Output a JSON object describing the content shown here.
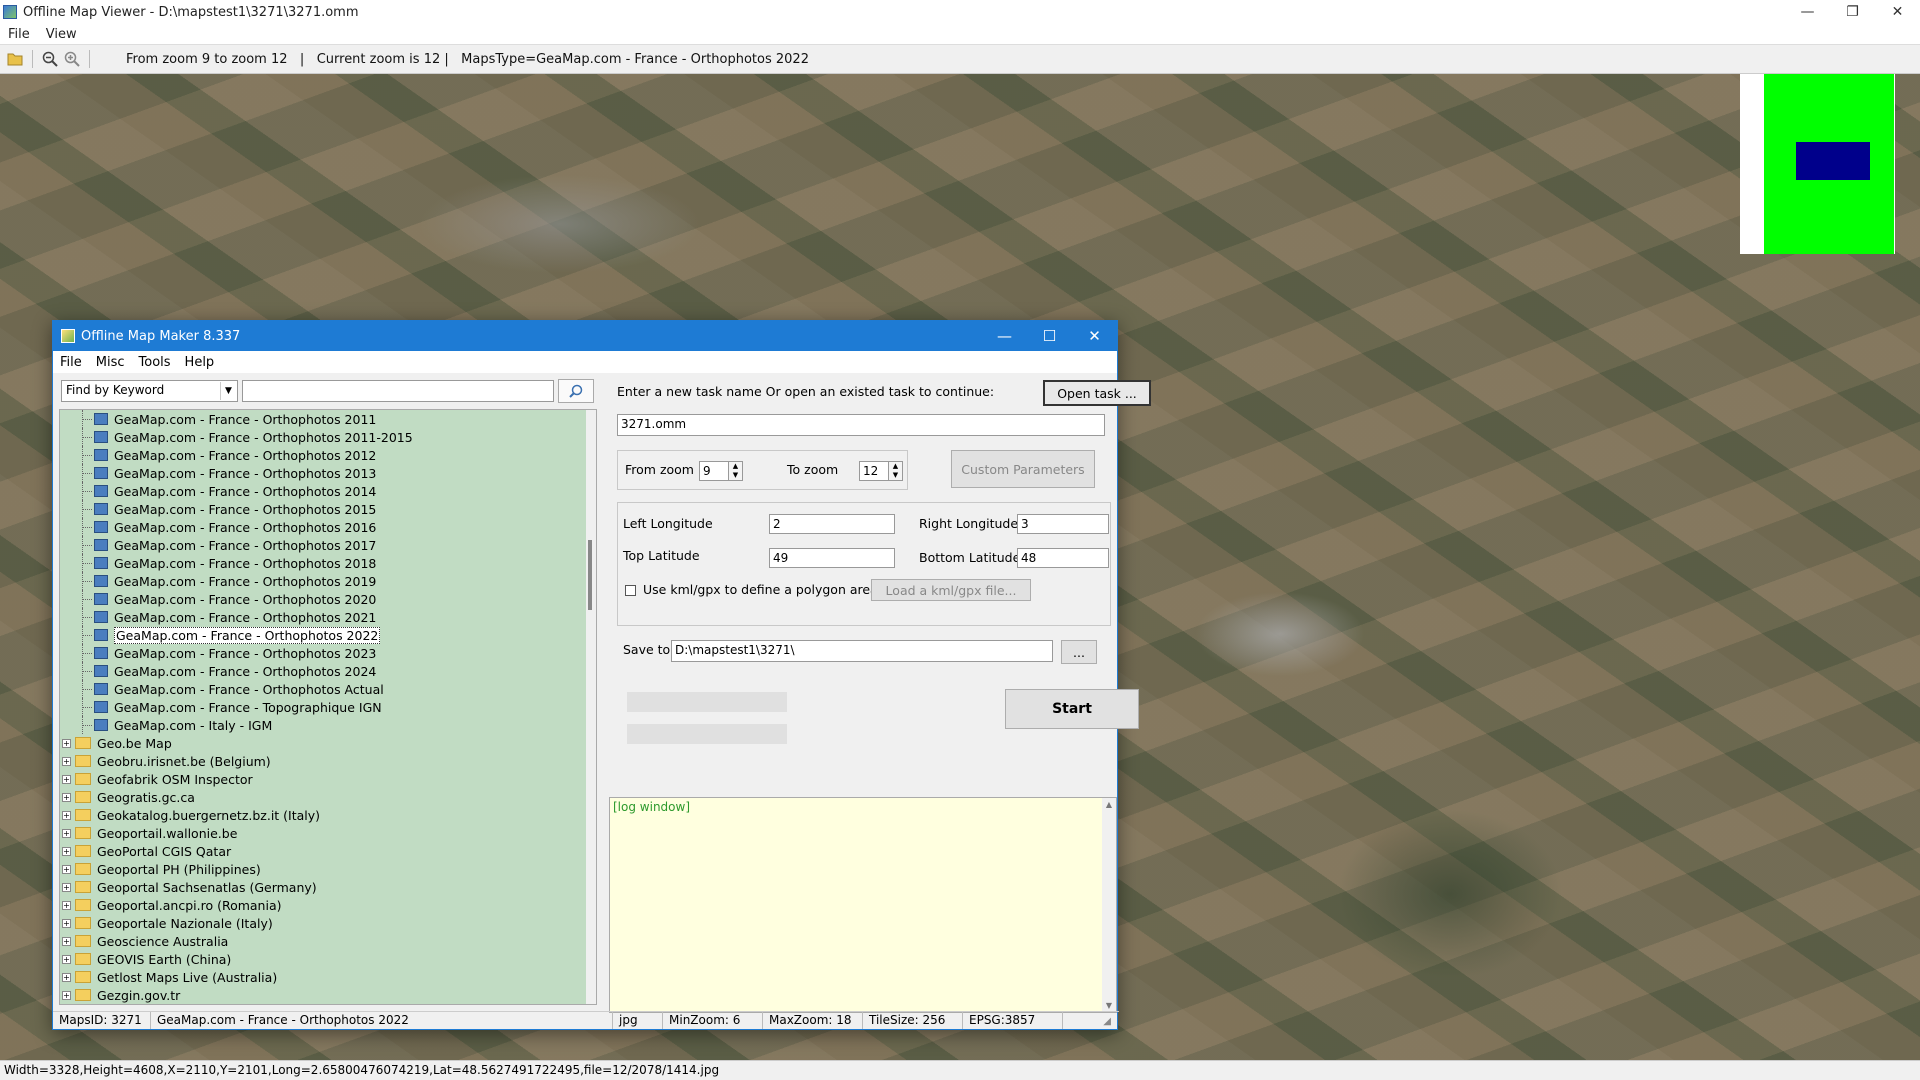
{
  "window": {
    "title": "Offline Map Viewer - D:\\mapstest1\\3271\\3271.omm",
    "controls": {
      "minimize": "—",
      "maximize": "❐",
      "close": "✕"
    }
  },
  "menu": {
    "file": "File",
    "view": "View"
  },
  "toolbar": {
    "open_icon": "folder-open-icon",
    "zoom_out_icon": "zoom-out-icon",
    "zoom_in_icon": "zoom-in-icon",
    "info": "From zoom 9 to zoom 12   |   Current zoom is 12 |   MapsType=GeaMap.com - France - Orthophotos 2022"
  },
  "status_bar": "Width=3328,Height=4608,X=2110,Y=2101,Long=2.65800476074219,Lat=48.5627491722495,file=12/2078/1414.jpg",
  "colors": {
    "dialog_title": "#1e7bd4",
    "tree_bg": "#c1dcc3",
    "log_bg": "#ffffdf",
    "minimap_green": "#00ff00",
    "minimap_view": "#00008b"
  },
  "dialog": {
    "title": "Offline Map Maker 8.337",
    "menu": {
      "file": "File",
      "misc": "Misc",
      "tools": "Tools",
      "help": "Help"
    },
    "search": {
      "mode": "Find by Keyword",
      "query": ""
    },
    "tree": {
      "children": [
        "GeaMap.com - France - Orthophotos 2011",
        "GeaMap.com - France - Orthophotos 2011-2015",
        "GeaMap.com - France - Orthophotos 2012",
        "GeaMap.com - France - Orthophotos 2013",
        "GeaMap.com - France - Orthophotos 2014",
        "GeaMap.com - France - Orthophotos 2015",
        "GeaMap.com - France - Orthophotos 2016",
        "GeaMap.com - France - Orthophotos 2017",
        "GeaMap.com - France - Orthophotos 2018",
        "GeaMap.com - France - Orthophotos 2019",
        "GeaMap.com - France - Orthophotos 2020",
        "GeaMap.com - France - Orthophotos 2021",
        "GeaMap.com - France - Orthophotos 2022",
        "GeaMap.com - France - Orthophotos 2023",
        "GeaMap.com - France - Orthophotos 2024",
        "GeaMap.com - France - Orthophotos Actual",
        "GeaMap.com - France - Topographique IGN",
        "GeaMap.com - Italy - IGM"
      ],
      "selected": "GeaMap.com - France - Orthophotos 2022",
      "folders": [
        "Geo.be Map",
        "Geobru.irisnet.be (Belgium)",
        "Geofabrik OSM Inspector",
        "Geogratis.gc.ca",
        "Geokatalog.buergernetz.bz.it (Italy)",
        "Geoportail.wallonie.be",
        "GeoPortal CGIS Qatar",
        "Geoportal PH (Philippines)",
        "Geoportal Sachsenatlas (Germany)",
        "Geoportal.ancpi.ro (Romania)",
        "Geoportale Nazionale (Italy)",
        "Geoscience Australia",
        "GEOVIS Earth (China)",
        "Getlost Maps Live (Australia)",
        "Gezgin.gov.tr"
      ]
    },
    "task_prompt": "Enter a new task name Or open an existed task to continue:",
    "open_task": "Open task ...",
    "task_name": "3271.omm",
    "from_zoom_label": "From zoom",
    "from_zoom": "9",
    "to_zoom_label": "To zoom",
    "to_zoom": "12",
    "custom_params": "Custom Parameters",
    "left_lon_label": "Left Longitude",
    "left_lon": "2",
    "right_lon_label": "Right Longitude",
    "right_lon": "3",
    "top_lat_label": "Top Latitude",
    "top_lat": "49",
    "bottom_lat_label": "Bottom Latitude",
    "bottom_lat": "48",
    "kml_label": "Use kml/gpx to define a polygon area",
    "load_kml": "Load a kml/gpx file...",
    "save_to_label": "Save to:",
    "save_to": "D:\\mapstest1\\3271\\",
    "browse": "...",
    "start": "Start",
    "log": "[log window]",
    "status": {
      "maps_id": "MapsID: 3271",
      "maps_name": "GeaMap.com - France - Orthophotos 2022",
      "format": "jpg",
      "min_zoom": "MinZoom: 6",
      "max_zoom": "MaxZoom: 18",
      "tile_size": "TileSize: 256",
      "epsg": "EPSG:3857"
    }
  }
}
